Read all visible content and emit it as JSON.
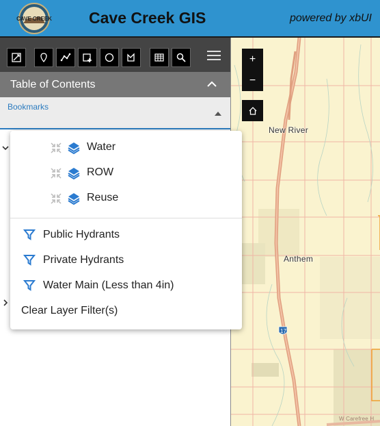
{
  "header": {
    "title": "Cave Creek GIS",
    "powered_by": "powered by xbUI",
    "logo_text": "CAVE CREEK",
    "bg_color": "#2f93cf"
  },
  "toolbar": {
    "icons": [
      "select-icon",
      "point-icon",
      "polyline-icon",
      "polygon-icon",
      "circle-icon",
      "freehand-icon",
      "table-icon",
      "search-icon",
      "menu-icon"
    ]
  },
  "toc": {
    "title": "Table of Contents"
  },
  "bookmarks": {
    "label": "Bookmarks"
  },
  "dropdown": {
    "groups": [
      {
        "label": "Water"
      },
      {
        "label": "ROW"
      },
      {
        "label": "Reuse"
      }
    ],
    "filters": [
      {
        "label": "Public Hydrants"
      },
      {
        "label": "Private Hydrants"
      },
      {
        "label": "Water Main (Less than 4in)"
      }
    ],
    "clear_label": "Clear Layer Filter(s)"
  },
  "map": {
    "zoom_in": "+",
    "zoom_out": "−",
    "places": {
      "new_river": "New River",
      "anthem": "Anthem",
      "highway": "17",
      "road": "W Carefree H"
    }
  }
}
